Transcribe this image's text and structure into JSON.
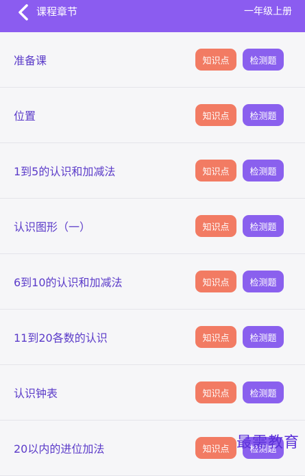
{
  "header": {
    "back_icon": "chevron-left-icon",
    "title": "课程章节",
    "grade": "一年级上册"
  },
  "colors": {
    "header_bg": "#8b5cf0",
    "knowledge_btn": "#f27b63",
    "test_btn": "#8a60ee",
    "chapter_text": "#5b3bc9"
  },
  "chapters": [
    {
      "title": "准备课",
      "knowledge_label": "知识点",
      "test_label": "检测题"
    },
    {
      "title": "位置",
      "knowledge_label": "知识点",
      "test_label": "检测题"
    },
    {
      "title": "1到5的认识和加减法",
      "knowledge_label": "知识点",
      "test_label": "检测题"
    },
    {
      "title": "认识图形（一）",
      "knowledge_label": "知识点",
      "test_label": "检测题"
    },
    {
      "title": "6到10的认识和加减法",
      "knowledge_label": "知识点",
      "test_label": "检测题"
    },
    {
      "title": "11到20各数的认识",
      "knowledge_label": "知识点",
      "test_label": "检测题"
    },
    {
      "title": "认识钟表",
      "knowledge_label": "知识点",
      "test_label": "检测题"
    },
    {
      "title": "20以内的进位加法",
      "knowledge_label": "知识点",
      "test_label": "检测题"
    }
  ],
  "watermark": "最需教育"
}
